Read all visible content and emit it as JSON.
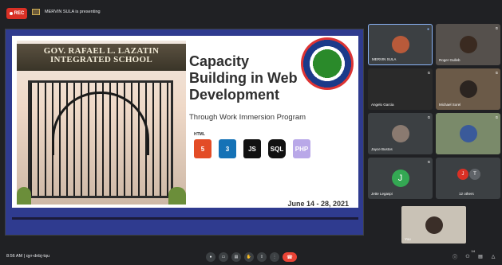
{
  "recording": {
    "label": "REC"
  },
  "presenter": {
    "text": "MERVIN SULA is presenting"
  },
  "slide": {
    "school_sign": "GOV. RAFAEL L. LAZATIN INTEGRATED SCHOOL",
    "title": "Capacity Building in Web Development",
    "subtitle": "Through Work Immersion Program",
    "date": "June 14 - 28, 2021",
    "tech_icons": [
      {
        "name": "html5-icon",
        "label": "5",
        "caption": "HTML"
      },
      {
        "name": "css3-icon",
        "label": "3"
      },
      {
        "name": "javascript-icon",
        "label": "JS"
      },
      {
        "name": "sql-icon",
        "label": "SQL"
      },
      {
        "name": "php-icon",
        "label": "PHP"
      }
    ]
  },
  "participants": [
    {
      "name": "MERVIN SULA",
      "initial": ""
    },
    {
      "name": "Roger Gulleb",
      "initial": ""
    },
    {
      "name": "Angelo Garcia",
      "initial": ""
    },
    {
      "name": "Michael Sorel",
      "initial": ""
    },
    {
      "name": "Jayce Bustos",
      "initial": ""
    },
    {
      "name": "",
      "initial": ""
    },
    {
      "name": "Jette Legaspi",
      "initial": "J"
    },
    {
      "name": "12 others",
      "initials": [
        "J",
        "T"
      ]
    }
  ],
  "self_view": {
    "name": "You"
  },
  "meeting": {
    "time": "8:56 AM",
    "separator": "|",
    "code": "qyr-dnbj-tqu"
  },
  "people_count": "14"
}
